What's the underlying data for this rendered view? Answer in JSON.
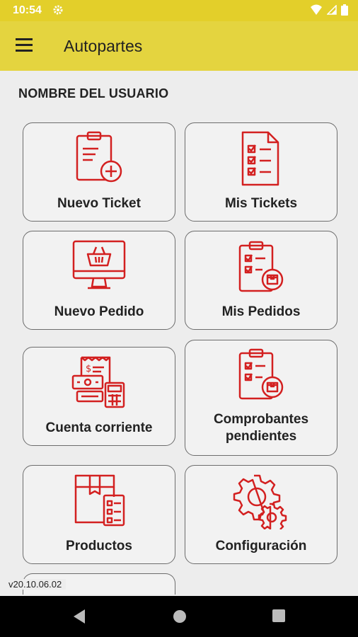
{
  "status_bar": {
    "time": "10:54"
  },
  "app_bar": {
    "title": "Autopartes"
  },
  "user": {
    "name": "NOMBRE DEL USUARIO"
  },
  "menu": [
    {
      "label": "Nuevo Ticket",
      "icon": "clipboard-plus-icon"
    },
    {
      "label": "Mis Tickets",
      "icon": "checklist-icon"
    },
    {
      "label": "Nuevo Pedido",
      "icon": "monitor-basket-icon"
    },
    {
      "label": "Mis Pedidos",
      "icon": "clipboard-box-icon"
    },
    {
      "label": "Cuenta corriente",
      "icon": "receipt-calculator-icon"
    },
    {
      "label": "Comprobantes pendientes",
      "icon": "clipboard-box-icon"
    },
    {
      "label": "Productos",
      "icon": "box-checklist-icon"
    },
    {
      "label": "Configuración",
      "icon": "gears-icon"
    }
  ],
  "version": "v20.10.06.02",
  "colors": {
    "accent": "#e4d43f",
    "icon": "#d32020"
  }
}
